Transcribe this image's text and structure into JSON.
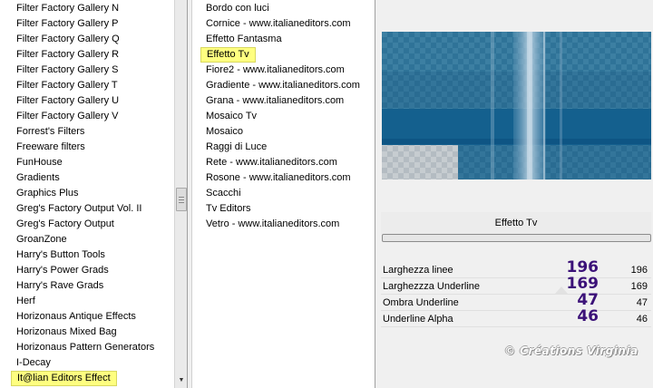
{
  "categories": {
    "items": [
      "Filter Factory Gallery N",
      "Filter Factory Gallery P",
      "Filter Factory Gallery Q",
      "Filter Factory Gallery R",
      "Filter Factory Gallery S",
      "Filter Factory Gallery T",
      "Filter Factory Gallery U",
      "Filter Factory Gallery V",
      "Forrest's Filters",
      "Freeware filters",
      "FunHouse",
      "Gradients",
      "Graphics Plus",
      "Greg's Factory Output Vol. II",
      "Greg's Factory Output",
      "GroanZone",
      "Harry's Button Tools",
      "Harry's Power Grads",
      "Harry's Rave Grads",
      "Herf",
      "Horizonaus Antique Effects",
      "Horizonaus Mixed Bag",
      "Horizonaus Pattern Generators",
      "I-Decay",
      "It@lian Editors Effect"
    ],
    "selected_index": 24
  },
  "effects": {
    "items": [
      "Bordo con luci",
      "Cornice - www.italianeditors.com",
      "Effetto Fantasma",
      "Effetto Tv",
      "Fiore2 - www.italianeditors.com",
      "Gradiente - www.italianeditors.com",
      "Grana - www.italianeditors.com",
      "Mosaico Tv",
      "Mosaico",
      "Raggi di Luce",
      "Rete - www.italianeditors.com",
      "Rosone - www.italianeditors.com",
      "Scacchi",
      "Tv Editors",
      "Vetro - www.italianeditors.com"
    ],
    "selected_index": 3
  },
  "filter_title": "Effetto Tv",
  "parameters": [
    {
      "label": "Larghezza linee",
      "highlight": "196",
      "value": "196"
    },
    {
      "label": "Larghezzza Underline",
      "highlight": "169",
      "value": "169"
    },
    {
      "label": "Ombra Underline",
      "highlight": "47",
      "value": "47"
    },
    {
      "label": "Underline Alpha",
      "highlight": "46",
      "value": "46"
    }
  ],
  "watermark": "© Créations Virginia",
  "icons": {
    "scroll_down": "triangle-down-icon"
  },
  "colors": {
    "selection": "#ffff80",
    "highlight_number": "#3b1178",
    "preview_blue": "#1f6a92",
    "preview_dark": "#0f5a88"
  }
}
